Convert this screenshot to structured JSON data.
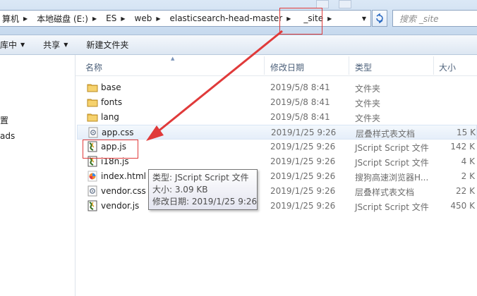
{
  "address_bar": {
    "breadcrumbs": [
      {
        "label": "算机"
      },
      {
        "label": "本地磁盘 (E:)"
      },
      {
        "label": "ES"
      },
      {
        "label": "web"
      },
      {
        "label": "elasticsearch-head-master"
      },
      {
        "label": "_site"
      }
    ],
    "search_placeholder": "搜索 _site"
  },
  "toolbar": {
    "include_in_library": "库中",
    "share": "共享",
    "new_folder": "新建文件夹"
  },
  "nav_pane": {
    "items": [
      "置",
      "ads"
    ]
  },
  "columns": {
    "name": "名称",
    "date": "修改日期",
    "type": "类型",
    "size": "大小"
  },
  "files": [
    {
      "name": "base",
      "date": "2019/5/8 8:41",
      "type": "文件夹",
      "size": "",
      "icon": "folder-icon"
    },
    {
      "name": "fonts",
      "date": "2019/5/8 8:41",
      "type": "文件夹",
      "size": "",
      "icon": "folder-icon"
    },
    {
      "name": "lang",
      "date": "2019/5/8 8:41",
      "type": "文件夹",
      "size": "",
      "icon": "folder-icon"
    },
    {
      "name": "app.css",
      "date": "2019/1/25 9:26",
      "type": "层叠样式表文档",
      "size": "15 K",
      "icon": "css-file-icon"
    },
    {
      "name": "app.js",
      "date": "2019/1/25 9:26",
      "type": "JScript Script 文件",
      "size": "142 K",
      "icon": "js-file-icon"
    },
    {
      "name": "i18n.js",
      "date": "2019/1/25 9:26",
      "type": "JScript Script 文件",
      "size": "4 K",
      "icon": "js-file-icon"
    },
    {
      "name": "index.html",
      "date": "2019/1/25 9:26",
      "type": "搜狗高速浏览器H...",
      "size": "2 K",
      "icon": "html-file-icon"
    },
    {
      "name": "vendor.css",
      "date": "2019/1/25 9:26",
      "type": "层叠样式表文档",
      "size": "22 K",
      "icon": "css-file-icon"
    },
    {
      "name": "vendor.js",
      "date": "2019/1/25 9:26",
      "type": "JScript Script 文件",
      "size": "450 K",
      "icon": "js-file-icon"
    }
  ],
  "tooltip": {
    "type_line": "类型: JScript Script 文件",
    "size_line": "大小: 3.09 KB",
    "date_line": "修改日期: 2019/1/25 9:26"
  },
  "colors": {
    "annotation_red": "#e03a3a",
    "header_text": "#4c607a"
  }
}
